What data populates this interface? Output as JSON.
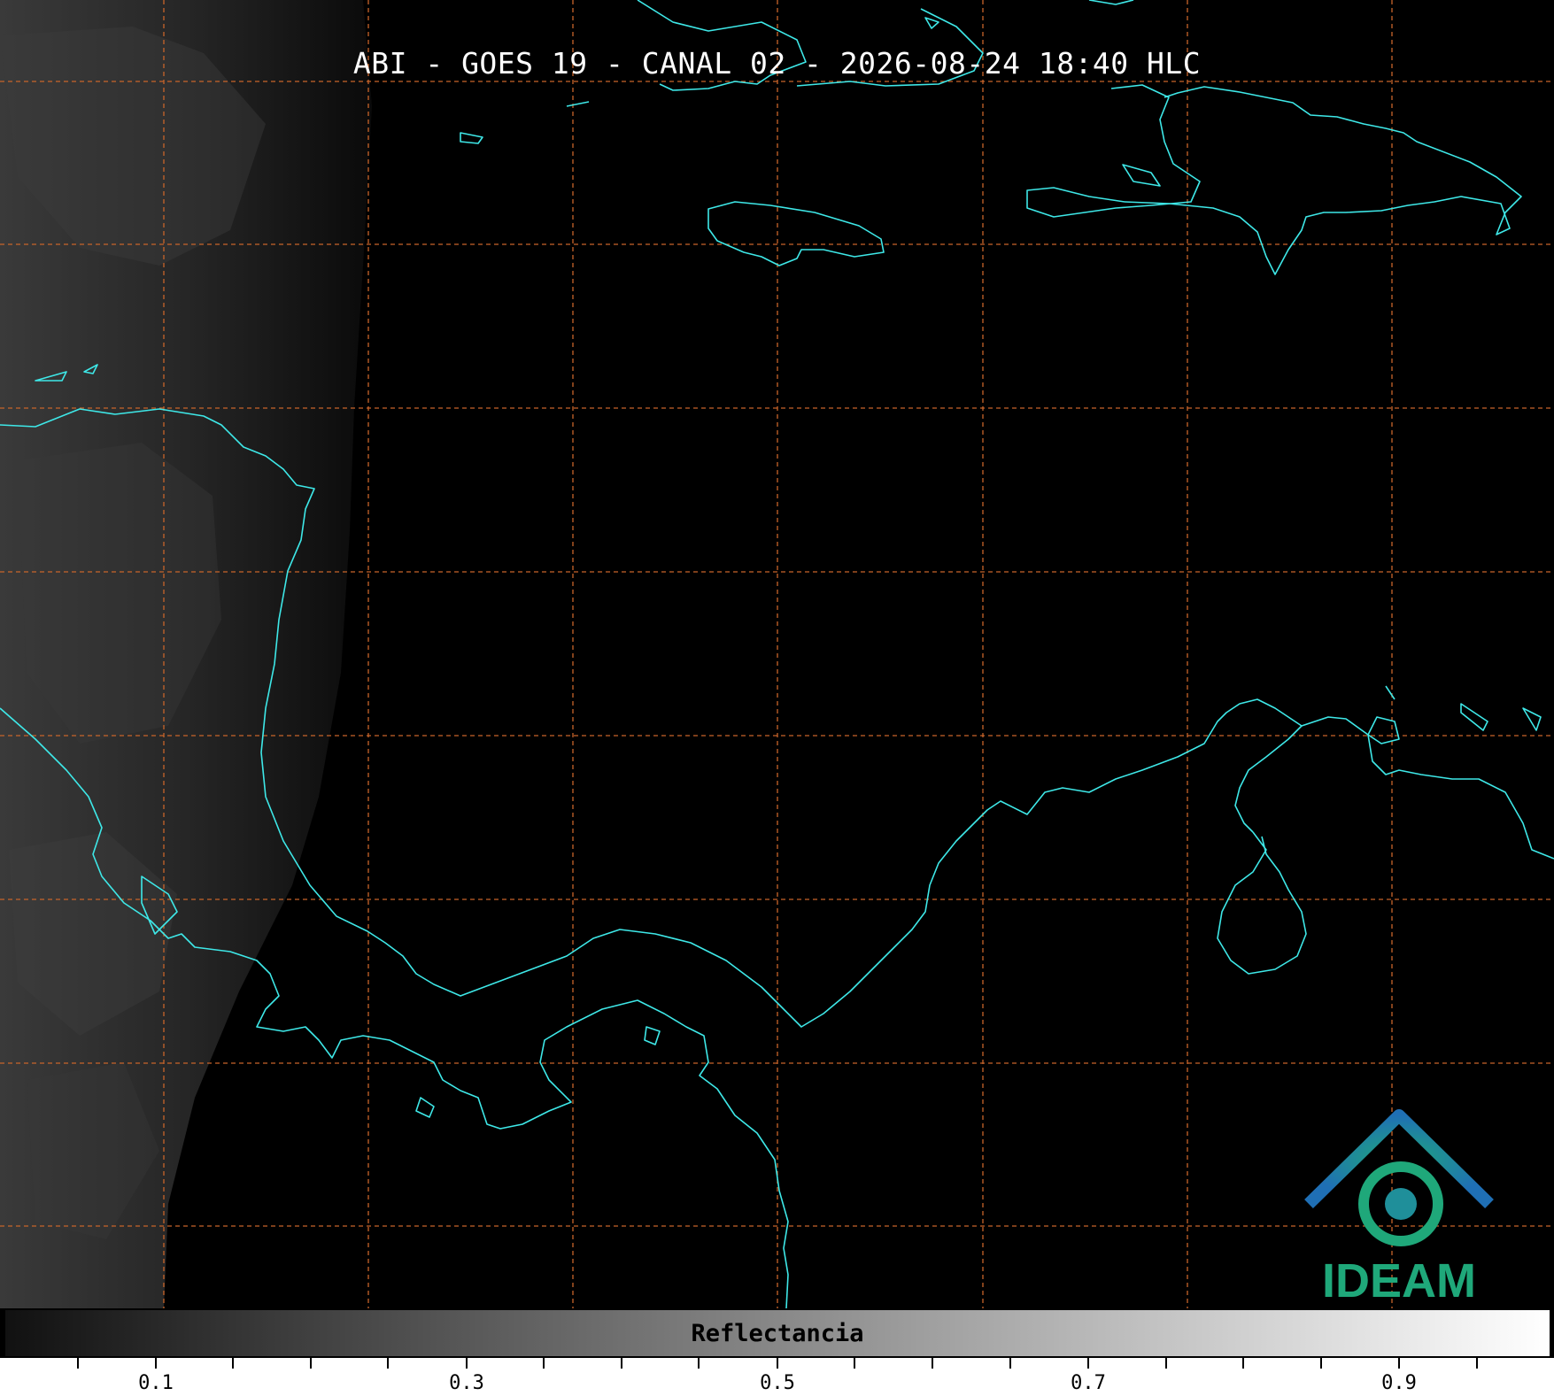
{
  "title": "ABI - GOES 19 - CANAL 02 - 2026-08-24 18:40 HLC",
  "colorbar": {
    "label": "Reflectancia",
    "ticks": [
      "0.1",
      "0.3",
      "0.5",
      "0.7",
      "0.9"
    ],
    "range": [
      0.0,
      1.0
    ],
    "colormap": [
      "#111111",
      "#ffffff"
    ]
  },
  "logo": {
    "text": "IDEAM",
    "colors": [
      "#1f6fb5",
      "#1fa87a"
    ]
  },
  "colors": {
    "coastline": "#3ee8e8",
    "grid": "#c8642a",
    "background": "#000000"
  }
}
